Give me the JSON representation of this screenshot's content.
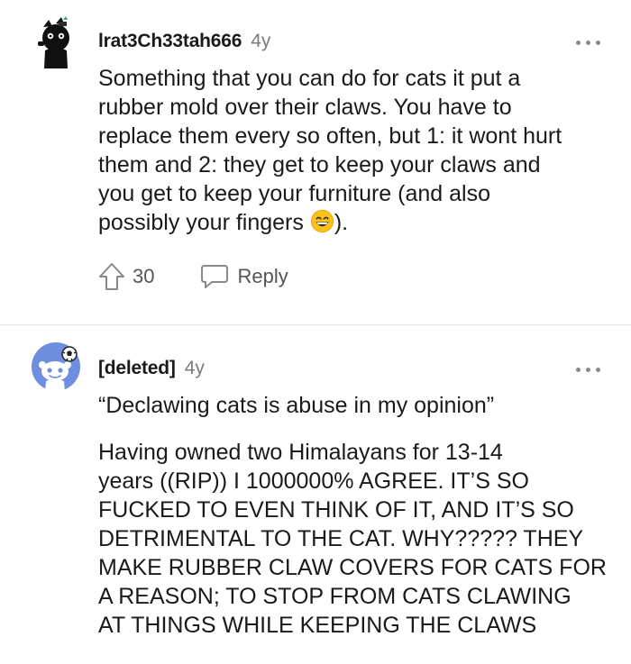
{
  "comments": [
    {
      "username": "lrat3Ch33tah666",
      "age": "4y",
      "body_lines": [
        "Something that you can do for cats it put a",
        "rubber mold over their claws. You have to",
        "replace them every so often, but 1: it wont hurt",
        "them and 2: they get to keep your claws and",
        "you get to keep your furniture (and also",
        "possibly your fingers"
      ],
      "body_end": ").",
      "emoji": "grinning-face-emoji",
      "votes": "30",
      "reply_label": "Reply"
    },
    {
      "username": "[deleted]",
      "age": "4y",
      "quote": "“Declawing cats is abuse in my opinion”",
      "body_lines": [
        "Having owned two Himalayans for 13-14",
        "years ((RIP)) I 1000000% AGREE. IT’S SO",
        "FUCKED TO EVEN THINK OF IT, AND IT’S SO",
        "DETRIMENTAL TO THE CAT. WHY????? THEY",
        "MAKE RUBBER CLAW COVERS FOR CATS FOR",
        "A REASON; TO STOP FROM CATS CLAWING",
        "AT THINGS WHILE KEEPING THE CLAWS"
      ]
    }
  ],
  "colors": {
    "text": "#1a1a1b",
    "meta": "#7c7c7c",
    "icon": "#878a8c",
    "divider": "#e6e6e6",
    "deleted_avatar_bg": "#6e8fe0"
  }
}
